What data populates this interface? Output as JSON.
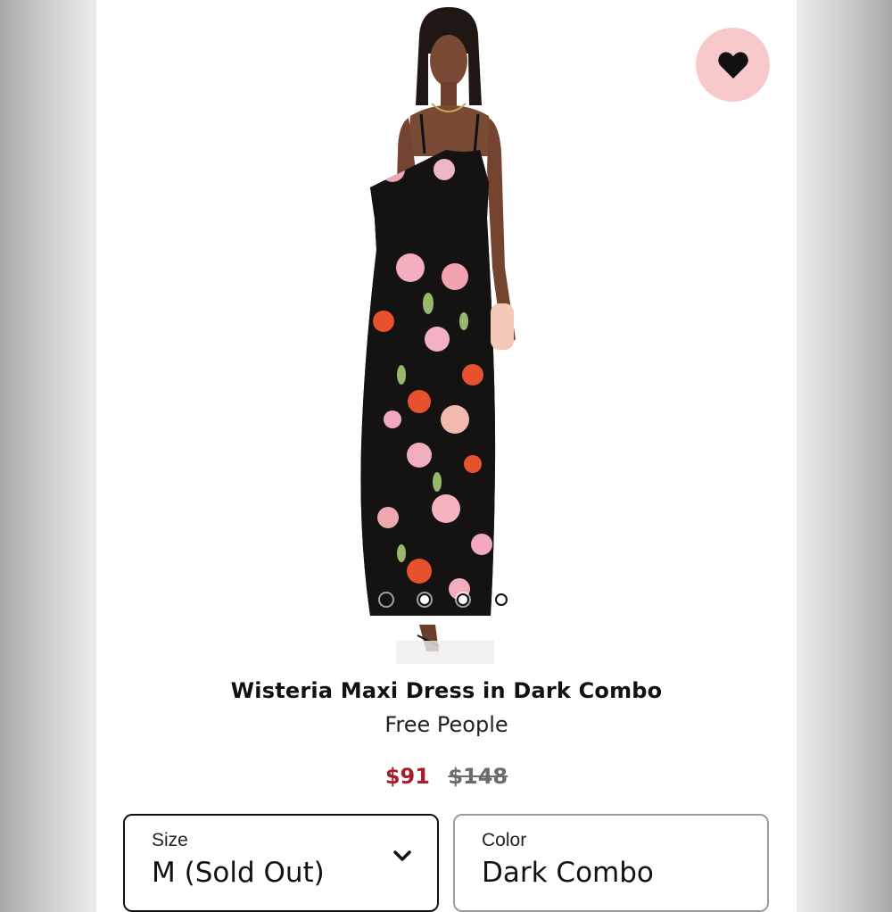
{
  "product": {
    "title": "Wisteria Maxi Dress in Dark Combo",
    "brand": "Free People",
    "price_sale": "$91",
    "price_original": "$148"
  },
  "gallery": {
    "image_count": 4,
    "active_index": 0
  },
  "size_select": {
    "label": "Size",
    "value": "M (Sold Out)"
  },
  "color_select": {
    "label": "Color",
    "value": "Dark Combo"
  },
  "icons": {
    "favorite": "heart-icon",
    "dropdown": "chevron-down-icon"
  },
  "colors": {
    "sale_price": "#a31f2b",
    "favorite_bg": "#f7c9cb"
  }
}
